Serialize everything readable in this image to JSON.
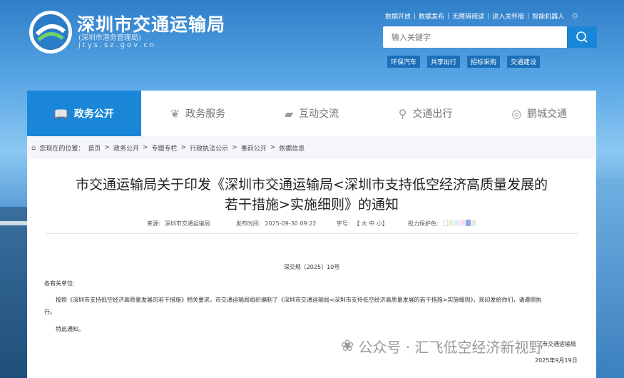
{
  "header": {
    "title": "深圳市交通运输局",
    "subtitle": "(深圳市港务管理局)",
    "url": "jtys.sz.gov.cn",
    "top_links": [
      "数据开放",
      "数据发布",
      "无障碍阅读",
      "进入关怀版",
      "智能机器人"
    ],
    "search_placeholder": "输入关键字",
    "tags": [
      "环保汽车",
      "共享出行",
      "招标采购",
      "交通建设"
    ]
  },
  "nav": [
    {
      "label": "政务公开",
      "icon": "book-icon",
      "active": true
    },
    {
      "label": "政务服务",
      "icon": "handshake-icon",
      "active": false
    },
    {
      "label": "互动交流",
      "icon": "chat-icon",
      "active": false
    },
    {
      "label": "交通出行",
      "icon": "map-person-icon",
      "active": false
    },
    {
      "label": "鹏城交通",
      "icon": "swirl-icon",
      "active": false
    }
  ],
  "breadcrumb": {
    "prefix": "您现在的位置：",
    "items": [
      "首页",
      "政务公开",
      "专题专栏",
      "行政执法公示",
      "事前公开",
      "依据信息"
    ]
  },
  "article": {
    "title_line1": "市交通运输局关于印发《深圳市交通运输局<深圳市支持低空经济高质量发展的",
    "title_line2": "若干措施>实施细则》的通知",
    "source_label": "来源:",
    "source_value": "深圳市交通运输局",
    "date_label": "发布时间:",
    "date_value": "2025-09-30 09:22",
    "font_label": "字号:",
    "font_value": "【 大 中 小】",
    "protect_label": "视力保护色:",
    "doc_number": "深交规〔2025〕10号",
    "salutation": "各有关单位:",
    "body_line1": "按照《深圳市支持低空经济高质量发展的若干措施》相关要求，市交通运输局组织编制了《深圳市交通运输局<深圳市支持低空经济高质量发展的若干措施>实施细则》，现印发给你们，请遵照执",
    "body_line2": "行。",
    "closing": "特此通知。",
    "signature": "市交通运输局",
    "sign_date": "2025年9月19日"
  },
  "watermark": "公众号 · 汇飞低空经济新视野",
  "colors": {
    "accent": "#1a86d8",
    "tag_bg": "#1a6fb8",
    "swatches": [
      "#ffffff",
      "#e6f4d9",
      "#dff0f8",
      "#f8e1ef",
      "#8fa9e8",
      "#e8e8e8"
    ]
  }
}
